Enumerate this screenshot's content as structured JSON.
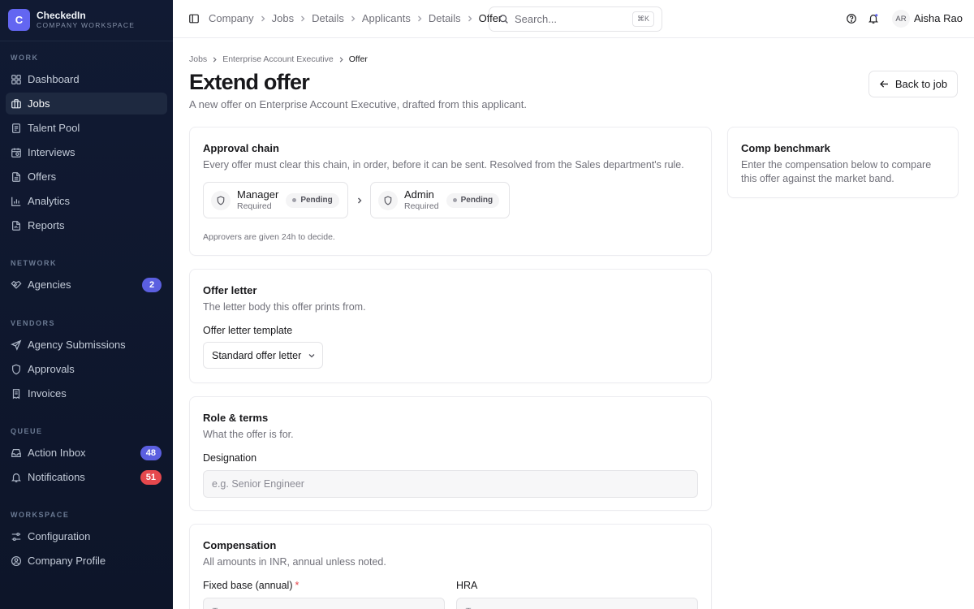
{
  "brand": {
    "initial": "C",
    "name": "CheckedIn",
    "subtitle": "COMPANY WORKSPACE"
  },
  "sidebar": {
    "sections": {
      "work": "WORK",
      "network": "NETWORK",
      "vendors": "VENDORS",
      "queue": "QUEUE",
      "workspace": "WORKSPACE"
    },
    "items": {
      "dashboard": {
        "label": "Dashboard",
        "icon": "grid-icon"
      },
      "jobs": {
        "label": "Jobs",
        "icon": "briefcase-icon",
        "active": true
      },
      "talent_pool": {
        "label": "Talent Pool",
        "icon": "document-icon"
      },
      "interviews": {
        "label": "Interviews",
        "icon": "calendar-icon"
      },
      "offers": {
        "label": "Offers",
        "icon": "file-icon"
      },
      "analytics": {
        "label": "Analytics",
        "icon": "bar-chart-icon"
      },
      "reports": {
        "label": "Reports",
        "icon": "report-icon"
      },
      "agencies": {
        "label": "Agencies",
        "icon": "handshake-icon",
        "badge": "2"
      },
      "agency_submissions": {
        "label": "Agency Submissions",
        "icon": "send-icon"
      },
      "approvals": {
        "label": "Approvals",
        "icon": "shield-icon"
      },
      "invoices": {
        "label": "Invoices",
        "icon": "receipt-icon"
      },
      "action_inbox": {
        "label": "Action Inbox",
        "icon": "inbox-icon",
        "badge": "48"
      },
      "notifications": {
        "label": "Notifications",
        "icon": "bell-icon",
        "badge": "51"
      },
      "configuration": {
        "label": "Configuration",
        "icon": "sliders-icon"
      },
      "company_profile": {
        "label": "Company Profile",
        "icon": "user-circle-icon"
      }
    }
  },
  "header": {
    "breadcrumbs": [
      "Company",
      "Jobs",
      "Details",
      "Applicants",
      "Details",
      "Offer"
    ],
    "search": {
      "placeholder": "Search...",
      "shortcut": "⌘K"
    },
    "user": {
      "initials": "AR",
      "name": "Aisha Rao"
    }
  },
  "page": {
    "breadcrumbs": [
      "Jobs",
      "Enterprise Account Executive",
      "Offer"
    ],
    "title": "Extend offer",
    "subtitle": "A new offer on Enterprise Account Executive, drafted from this applicant.",
    "back_label": "Back to job"
  },
  "approval_chain": {
    "title": "Approval chain",
    "description": "Every offer must clear this chain, in order, before it can be sent. Resolved from the Sales department's rule.",
    "approvers": [
      {
        "name": "Manager",
        "requirement": "Required",
        "status": "Pending"
      },
      {
        "name": "Admin",
        "requirement": "Required",
        "status": "Pending"
      }
    ],
    "note": "Approvers are given 24h to decide."
  },
  "offer_letter": {
    "title": "Offer letter",
    "description": "The letter body this offer prints from.",
    "template_label": "Offer letter template",
    "template_value": "Standard offer letter"
  },
  "role_terms": {
    "title": "Role & terms",
    "description": "What the offer is for.",
    "designation_label": "Designation",
    "designation_placeholder": "e.g. Senior Engineer"
  },
  "compensation": {
    "title": "Compensation",
    "description": "All amounts in INR, annual unless noted.",
    "fixed_base_label": "Fixed base (annual)",
    "required_mark": "*",
    "hra_label": "HRA",
    "currency_symbol": "₹"
  },
  "benchmark": {
    "title": "Comp benchmark",
    "description": "Enter the compensation below to compare this offer against the market band."
  },
  "colors": {
    "accent": "#6366f1",
    "sidebar_bg": "#111a33",
    "badge_indigo": "#5b5fe0",
    "badge_red": "#e5484d"
  }
}
